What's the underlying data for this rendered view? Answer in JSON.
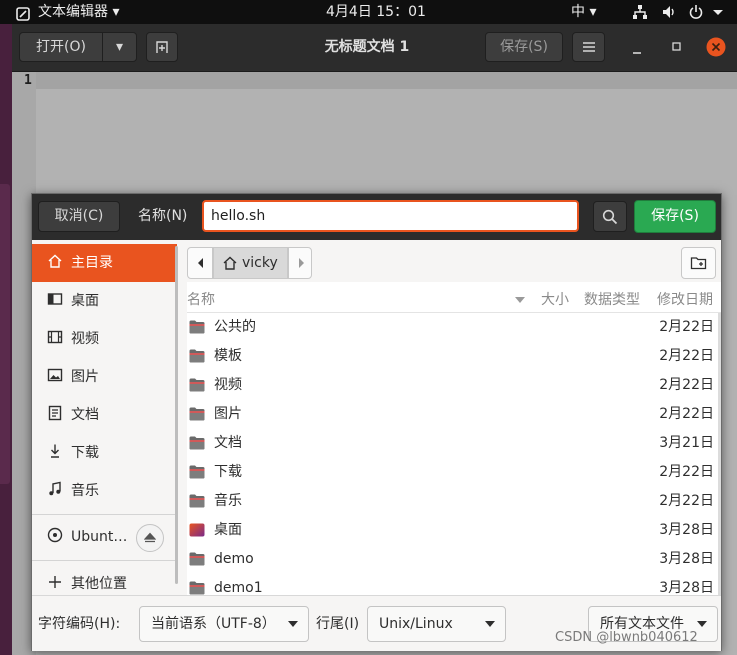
{
  "topbar": {
    "app_menu": "文本编辑器",
    "clock": "4月4日  15：01",
    "input_method": "中"
  },
  "editor": {
    "open_label": "打开(O)",
    "title": "无标题文档 1",
    "save_label": "保存(S)",
    "line_number": "1"
  },
  "dialog": {
    "cancel_label": "取消(C)",
    "name_label": "名称(N)",
    "filename_value": "hello.sh",
    "save_label": "保存(S)",
    "breadcrumb": "vicky",
    "sidebar": [
      {
        "label": "主目录",
        "icon": "home-icon",
        "active": true
      },
      {
        "label": "桌面",
        "icon": "desktop-icon"
      },
      {
        "label": "视频",
        "icon": "video-icon"
      },
      {
        "label": "图片",
        "icon": "picture-icon"
      },
      {
        "label": "文档",
        "icon": "document-icon"
      },
      {
        "label": "下载",
        "icon": "download-icon"
      },
      {
        "label": "音乐",
        "icon": "music-icon"
      },
      {
        "label": "Ubunt…",
        "icon": "disc-icon"
      },
      {
        "label": "其他位置",
        "icon": "plus-icon"
      }
    ],
    "columns": {
      "name": "名称",
      "size": "大小",
      "type": "数据类型",
      "modified": "修改日期"
    },
    "files": [
      {
        "name": "公共的",
        "date": "2月22日"
      },
      {
        "name": "模板",
        "date": "2月22日"
      },
      {
        "name": "视频",
        "date": "2月22日"
      },
      {
        "name": "图片",
        "date": "2月22日"
      },
      {
        "name": "文档",
        "date": "3月21日"
      },
      {
        "name": "下载",
        "date": "2月22日"
      },
      {
        "name": "音乐",
        "date": "2月22日"
      },
      {
        "name": "桌面",
        "date": "3月28日",
        "special": true
      },
      {
        "name": "demo",
        "date": "3月28日"
      },
      {
        "name": "demo1",
        "date": "3月28日"
      }
    ],
    "footer": {
      "encoding_label": "字符编码(H):",
      "encoding_value": "当前语系（UTF-8）",
      "line_end_label": "行尾(I)",
      "line_end_value": "Unix/Linux",
      "filter_value": "所有文本文件"
    }
  },
  "watermark": "CSDN @lbwnb040612",
  "colors": {
    "accent": "#e9541f",
    "save_green": "#2aa952",
    "topbar": "#0f0f0f"
  }
}
